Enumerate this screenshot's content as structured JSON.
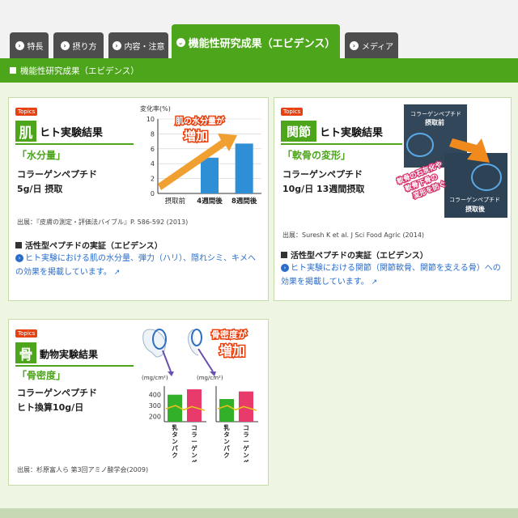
{
  "tabs": [
    {
      "label": "特長",
      "icon": "chevron-right-icon"
    },
    {
      "label": "摂り方",
      "icon": "chevron-right-icon"
    },
    {
      "label": "内容・注意",
      "icon": "chevron-right-icon"
    },
    {
      "label": "機能性研究成果（エビデンス）",
      "icon": "chevron-down-icon",
      "active": true
    },
    {
      "label": "メディア",
      "icon": "chevron-right-icon"
    }
  ],
  "section_title": "機能性研究成果（エビデンス）",
  "colors": {
    "accent": "#4ca51a",
    "tab_dark": "#4d4d4d",
    "topics": "#e8400e",
    "link": "#2a6cc9",
    "bar_blue": "#2f8fd6",
    "bar_green": "#33b02a",
    "bar_pink": "#e83a6b"
  },
  "cards": {
    "skin": {
      "topics": "Topics",
      "kanji": "肌",
      "subtitle": "ヒト実験結果",
      "quote": "「水分量」",
      "product": "コラーゲンペプチド",
      "dose": "5g/日 摂取",
      "source": "出展：『皮膚の測定・評価法バイブル』P. 586-592 (2013)",
      "evidence_heading": "活性型ペプチドの実証（エビデンス）",
      "evidence_link": "ヒト実験における肌の水分量、弾力（ハリ）、隠れシミ、キメへの効果を掲載しています。"
    },
    "joint": {
      "topics": "Topics",
      "kanji": "関節",
      "subtitle": "ヒト実験結果",
      "quote": "「軟骨の変形」",
      "product": "コラーゲンペプチド",
      "dose": "10g/日 13週間摂取",
      "source": "出展：Suresh K et al.  J Sci Food Agric (2014)",
      "evidence_heading": "活性型ペプチドの実証（エビデンス）",
      "evidence_link": "ヒト実験における関節（関節軟骨、関節を支える骨）への効果を掲載しています。",
      "xray_before": "コラーゲンペプチド\n摂取前",
      "xray_after": "コラーゲンペプチド\n摂取後",
      "xray_caption": "軟骨の石灰化や\n軟骨下骨の\n変形を防ぐ"
    },
    "bone": {
      "topics": "Topics",
      "kanji": "骨",
      "subtitle": "動物実験結果",
      "quote": "「骨密度」",
      "product": "コラーゲンペプチド",
      "dose": "ヒト換算10g/日",
      "source": "出展：杉原富人ら 第3回アミノ酸学会(2009)",
      "callout_top": "骨密度が",
      "callout_big": "増加"
    }
  },
  "chart_data": [
    {
      "type": "bar",
      "ylabel": "変化率(%)",
      "ylim": [
        0,
        10
      ],
      "yticks": [
        0,
        2,
        4,
        6,
        8,
        10
      ],
      "categories": [
        "摂取前",
        "4週間後",
        "8週間後"
      ],
      "values": [
        0,
        4.8,
        6.7
      ],
      "annotation_top": "肌の水分量が",
      "annotation_big": "増加"
    },
    {
      "type": "bar",
      "ylabel": "(mg/cm²)",
      "yticks": [
        200,
        300,
        400
      ],
      "categories": [
        "乳タンパク",
        "コラーゲンペプチド"
      ],
      "values": [
        400,
        450
      ]
    },
    {
      "type": "bar",
      "ylabel": "(mg/cm²)",
      "yticks": [],
      "categories": [
        "乳タンパク",
        "コラーゲンペプチド"
      ],
      "values": [
        360,
        430
      ]
    }
  ]
}
